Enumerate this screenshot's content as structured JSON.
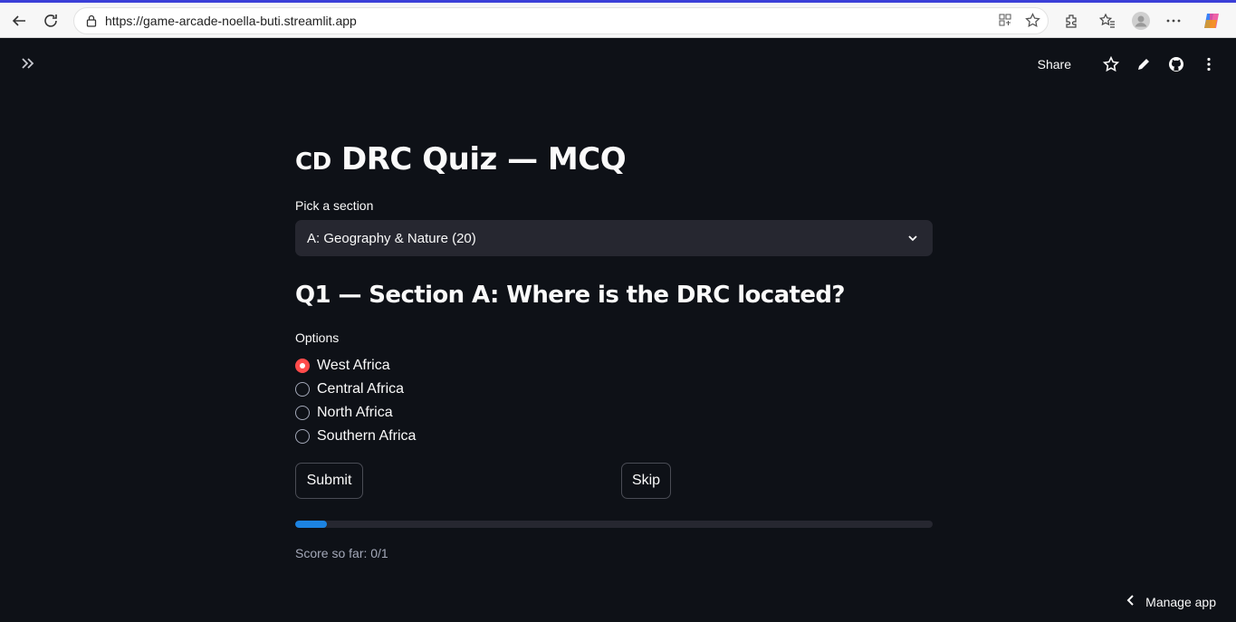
{
  "browser": {
    "url": "https://game-arcade-noella-buti.streamlit.app"
  },
  "header": {
    "share_label": "Share"
  },
  "main": {
    "title_flag": "CD",
    "title_text": "DRC Quiz — MCQ",
    "section_label": "Pick a section",
    "section_selected": "A: Geography & Nature (20)",
    "question": "Q1 — Section A: Where is the DRC located?",
    "options_label": "Options",
    "options": [
      {
        "label": "West Africa",
        "selected": true
      },
      {
        "label": "Central Africa",
        "selected": false
      },
      {
        "label": "North Africa",
        "selected": false
      },
      {
        "label": "Southern Africa",
        "selected": false
      }
    ],
    "submit_label": "Submit",
    "skip_label": "Skip",
    "progress_fraction": 0.05,
    "score_text": "Score so far: 0/1"
  },
  "footer": {
    "manage_label": "Manage app"
  },
  "colors": {
    "background": "#0e1117",
    "accent": "#ff4b4b",
    "progress": "#1c83e1"
  }
}
